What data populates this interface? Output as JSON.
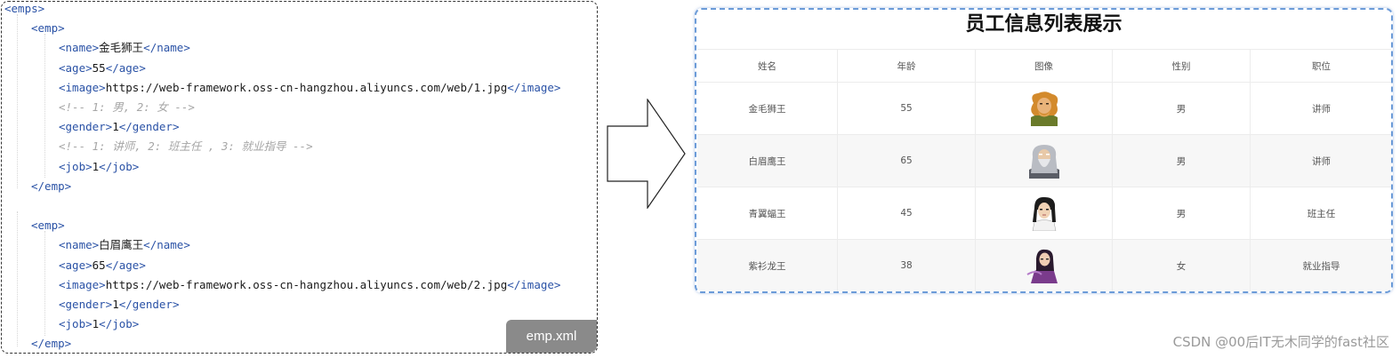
{
  "code": {
    "lines": [
      {
        "parts": [
          {
            "t": "tag",
            "v": "<emps>"
          }
        ]
      },
      {
        "parts": [
          {
            "t": "tag",
            "v": "<emp>"
          }
        ]
      },
      {
        "parts": [
          {
            "t": "tag",
            "v": "<name>"
          },
          {
            "t": "txt",
            "v": "金毛狮王"
          },
          {
            "t": "tag",
            "v": "</name>"
          }
        ]
      },
      {
        "parts": [
          {
            "t": "tag",
            "v": "<age>"
          },
          {
            "t": "txt",
            "v": "55"
          },
          {
            "t": "tag",
            "v": "</age>"
          }
        ]
      },
      {
        "parts": [
          {
            "t": "tag",
            "v": "<image>"
          },
          {
            "t": "txt",
            "v": "https://web-framework.oss-cn-hangzhou.aliyuncs.com/web/1.jpg"
          },
          {
            "t": "tag",
            "v": "</image>"
          }
        ]
      },
      {
        "comment": "<!-- 1: 男, 2: 女 -->"
      },
      {
        "parts": [
          {
            "t": "tag",
            "v": "<gender>"
          },
          {
            "t": "txt",
            "v": "1"
          },
          {
            "t": "tag",
            "v": "</gender>"
          }
        ]
      },
      {
        "comment": "<!-- 1: 讲师, 2: 班主任 , 3: 就业指导 -->"
      },
      {
        "parts": [
          {
            "t": "tag",
            "v": "<job>"
          },
          {
            "t": "txt",
            "v": "1"
          },
          {
            "t": "tag",
            "v": "</job>"
          }
        ]
      },
      {
        "parts": [
          {
            "t": "tag",
            "v": "</emp>"
          }
        ]
      },
      {
        "parts": []
      },
      {
        "parts": [
          {
            "t": "tag",
            "v": "<emp>"
          }
        ]
      },
      {
        "parts": [
          {
            "t": "tag",
            "v": "<name>"
          },
          {
            "t": "txt",
            "v": "白眉鹰王"
          },
          {
            "t": "tag",
            "v": "</name>"
          }
        ]
      },
      {
        "parts": [
          {
            "t": "tag",
            "v": "<age>"
          },
          {
            "t": "txt",
            "v": "65"
          },
          {
            "t": "tag",
            "v": "</age>"
          }
        ]
      },
      {
        "parts": [
          {
            "t": "tag",
            "v": "<image>"
          },
          {
            "t": "txt",
            "v": "https://web-framework.oss-cn-hangzhou.aliyuncs.com/web/2.jpg"
          },
          {
            "t": "tag",
            "v": "</image>"
          }
        ]
      },
      {
        "parts": [
          {
            "t": "tag",
            "v": "<gender>"
          },
          {
            "t": "txt",
            "v": "1"
          },
          {
            "t": "tag",
            "v": "</gender>"
          }
        ]
      },
      {
        "parts": [
          {
            "t": "tag",
            "v": "<job>"
          },
          {
            "t": "txt",
            "v": "1"
          },
          {
            "t": "tag",
            "v": "</job>"
          }
        ]
      },
      {
        "parts": [
          {
            "t": "tag",
            "v": "</emp>"
          }
        ]
      }
    ],
    "file_label": "emp.xml"
  },
  "table": {
    "title": "员工信息列表展示",
    "headers": [
      "姓名",
      "年龄",
      "图像",
      "性别",
      "职位"
    ],
    "rows": [
      {
        "name": "金毛狮王",
        "age": "55",
        "avatar": "golden-lion-king",
        "gender": "男",
        "job": "讲师"
      },
      {
        "name": "白眉鹰王",
        "age": "65",
        "avatar": "white-brow-eagle-king",
        "gender": "男",
        "job": "讲师"
      },
      {
        "name": "青翼蝠王",
        "age": "45",
        "avatar": "green-wing-bat-king",
        "gender": "男",
        "job": "班主任"
      },
      {
        "name": "紫衫龙王",
        "age": "38",
        "avatar": "purple-robe-dragon-king",
        "gender": "女",
        "job": "就业指导"
      }
    ]
  },
  "watermark": "CSDN @00后IT无木同学的fast社区",
  "colors": {
    "tag": "#2a52a6",
    "comment": "#a6a6a6",
    "panel_border": "#6b9bd8",
    "badge": "#8a8a8a"
  }
}
